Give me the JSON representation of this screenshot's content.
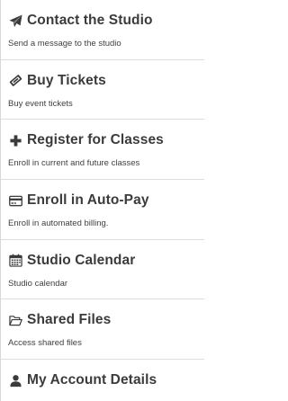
{
  "menu": {
    "items": [
      {
        "title": "Contact the Studio",
        "description": "Send a message to the studio",
        "icon": "paper-plane-icon"
      },
      {
        "title": "Buy Tickets",
        "description": "Buy event tickets",
        "icon": "ticket-icon"
      },
      {
        "title": "Register for Classes",
        "description": "Enroll in current and future classes",
        "icon": "plus-icon"
      },
      {
        "title": "Enroll in Auto-Pay",
        "description": "Enroll in automated billing.",
        "icon": "credit-card-icon"
      },
      {
        "title": "Studio Calendar",
        "description": "Studio calendar",
        "icon": "calendar-icon"
      },
      {
        "title": "Shared Files",
        "description": "Access shared files",
        "icon": "folder-open-icon"
      },
      {
        "title": "My Account Details",
        "description": "",
        "icon": "user-icon"
      }
    ]
  },
  "colors": {
    "text": "#3b3b3b",
    "divider": "#dedede",
    "background": "#ffffff"
  }
}
